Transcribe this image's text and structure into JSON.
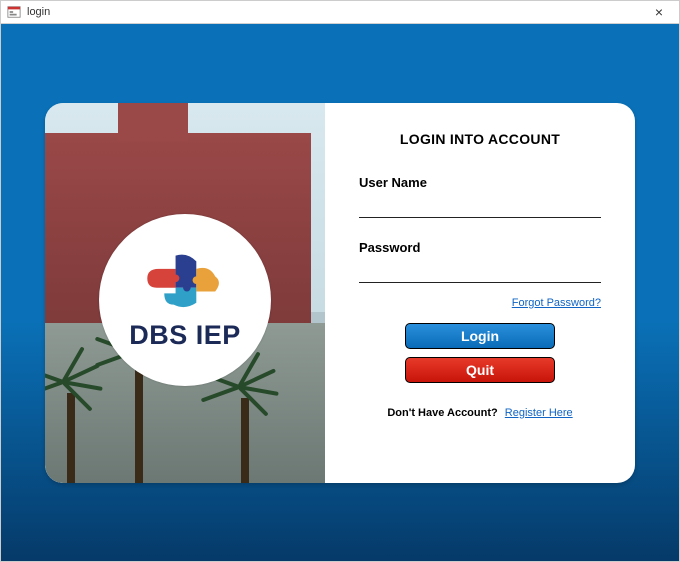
{
  "window": {
    "title": "login"
  },
  "logo": {
    "text": "DBS IEP"
  },
  "form": {
    "heading": "LOGIN INTO ACCOUNT",
    "username_label": "User Name",
    "username_value": "",
    "password_label": "Password",
    "password_value": "",
    "forgot_link": "Forgot Password?",
    "login_button": "Login",
    "quit_button": "Quit",
    "register_label": "Don't Have Account?",
    "register_link": "Register Here"
  },
  "colors": {
    "accent_blue": "#0a71b8",
    "button_red": "#d6201a",
    "link_blue": "#1064c4"
  }
}
